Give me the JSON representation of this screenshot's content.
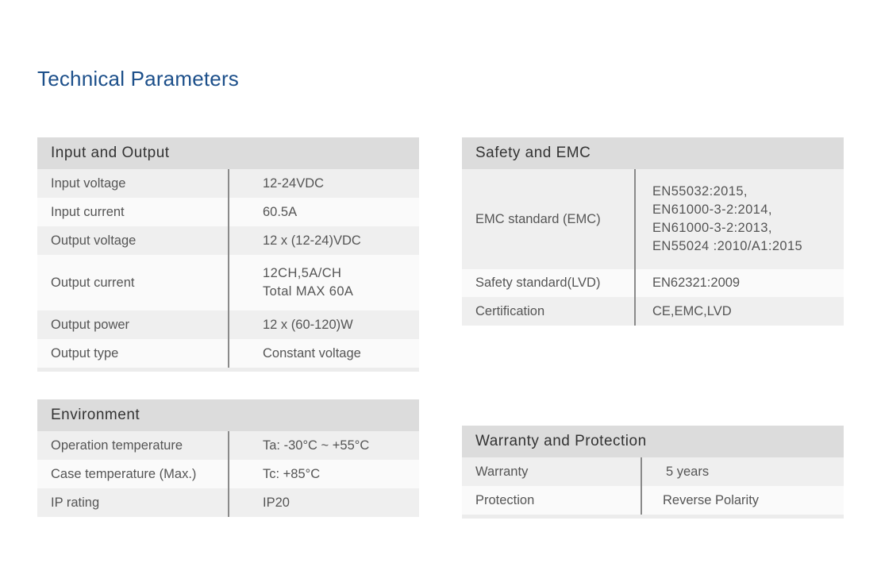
{
  "page": {
    "title": "Technical Parameters"
  },
  "input_output": {
    "heading": "Input and Output",
    "rows": [
      {
        "label": "Input voltage",
        "value": "12-24VDC"
      },
      {
        "label": "Input current",
        "value": "60.5A"
      },
      {
        "label": "Output voltage",
        "value": "12 x (12-24)VDC"
      },
      {
        "label": "Output current",
        "value": "12CH,5A/CH\nTotal MAX 60A"
      },
      {
        "label": "Output power",
        "value": "12 x (60-120)W"
      },
      {
        "label": "Output type",
        "value": "Constant voltage"
      }
    ]
  },
  "environment": {
    "heading": "Environment",
    "rows": [
      {
        "label": "Operation temperature",
        "value": "Ta: -30°C ~ +55°C"
      },
      {
        "label": "Case temperature (Max.)",
        "value": "Tc: +85°C"
      },
      {
        "label": "IP rating",
        "value": "IP20"
      }
    ]
  },
  "safety_emc": {
    "heading": "Safety and EMC",
    "rows": [
      {
        "label": "EMC standard (EMC)",
        "value": "EN55032:2015,\nEN61000-3-2:2014,\nEN61000-3-2:2013,\nEN55024 :2010/A1:2015"
      },
      {
        "label": "Safety standard(LVD)",
        "value": "EN62321:2009"
      },
      {
        "label": "Certification",
        "value": "CE,EMC,LVD"
      }
    ]
  },
  "warranty_protection": {
    "heading": "Warranty and Protection",
    "rows": [
      {
        "label": "Warranty",
        "value": "5 years"
      },
      {
        "label": "Protection",
        "value": "Reverse Polarity"
      }
    ]
  }
}
